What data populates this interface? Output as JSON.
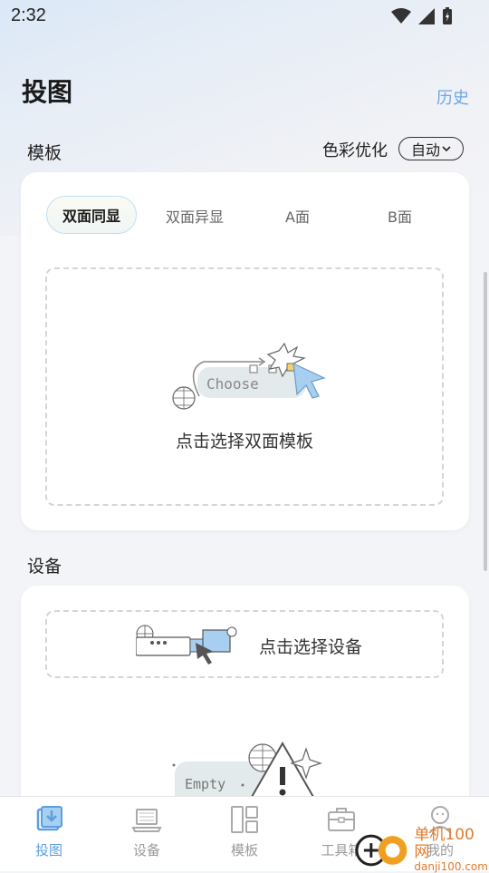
{
  "status": {
    "time": "2:32"
  },
  "header": {
    "title": "投图",
    "history_label": "历史"
  },
  "template_section": {
    "label": "模板",
    "color_opt_label": "色彩优化",
    "color_opt_value": "自动",
    "tabs": [
      {
        "label": "双面同显",
        "active": true
      },
      {
        "label": "双面异显",
        "active": false
      },
      {
        "label": "A面",
        "active": false
      },
      {
        "label": "B面",
        "active": false
      }
    ],
    "choose_illustration_text": "Choose",
    "drop_text": "点击选择双面模板"
  },
  "device_section": {
    "label": "设备",
    "drop_text": "点击选择设备",
    "empty_illustration_text": "Empty"
  },
  "tabbar": {
    "items": [
      {
        "label": "投图",
        "icon": "cast-download-icon",
        "active": true
      },
      {
        "label": "设备",
        "icon": "laptop-icon",
        "active": false
      },
      {
        "label": "模板",
        "icon": "template-grid-icon",
        "active": false
      },
      {
        "label": "工具箱",
        "icon": "toolbox-icon",
        "active": false
      },
      {
        "label": "我的",
        "icon": "user-icon",
        "active": false
      }
    ]
  },
  "watermark": {
    "line1": "单机100网",
    "line2": "danji100.com"
  },
  "colors": {
    "accent": "#5a9fe0",
    "link": "#6aa8e6",
    "inactive": "#9a9a9a"
  }
}
